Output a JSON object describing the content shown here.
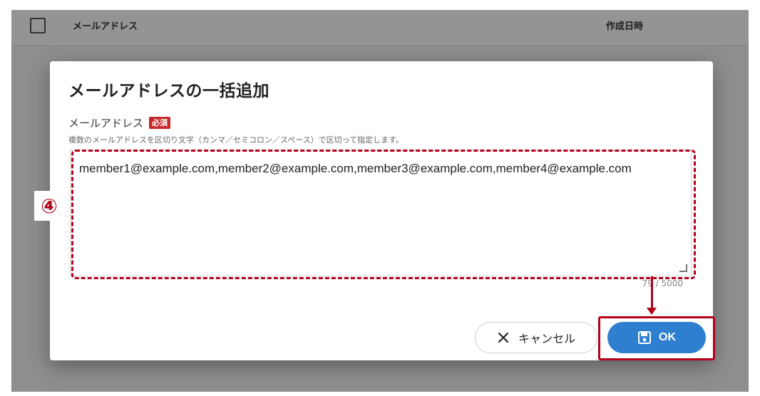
{
  "background": {
    "columns": {
      "email": "メールアドレス",
      "created_at": "作成日時"
    }
  },
  "dialog": {
    "title": "メールアドレスの一括追加",
    "field": {
      "label": "メールアドレス",
      "required_badge": "必須",
      "help": "複数のメールアドレスを区切り文字（カンマ／セミコロン／スペース）で区切って指定します。",
      "value": "member1@example.com,member2@example.com,member3@example.com,member4@example.com",
      "char_count": "79 / 5000"
    },
    "buttons": {
      "cancel_label": "キャンセル",
      "ok_label": "OK"
    }
  },
  "annotations": {
    "step_number": "④",
    "accent_color": "#b3001b"
  },
  "colors": {
    "primary": "#2f7fd0",
    "required": "#c62828"
  },
  "icons": {
    "cancel": "close-icon",
    "ok": "save-icon"
  }
}
